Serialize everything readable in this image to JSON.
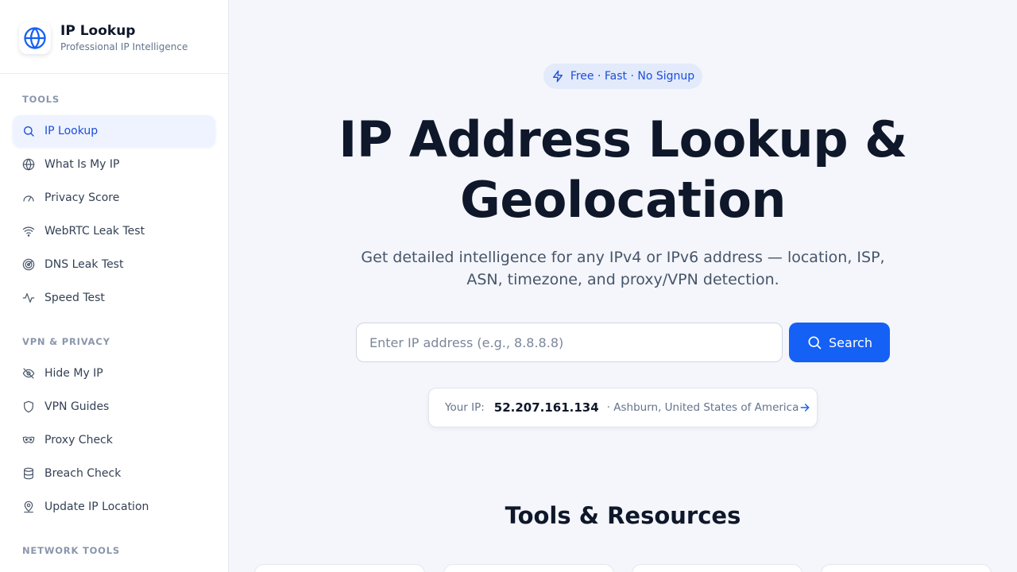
{
  "brand": {
    "title": "IP Lookup",
    "subtitle": "Professional IP Intelligence",
    "logo_icon": "globe-icon"
  },
  "sidebar": {
    "sections": [
      {
        "heading": "TOOLS",
        "items": [
          {
            "label": "IP Lookup",
            "icon": "search-icon",
            "active": true
          },
          {
            "label": "What Is My IP",
            "icon": "globe-icon"
          },
          {
            "label": "Privacy Score",
            "icon": "gauge-icon"
          },
          {
            "label": "WebRTC Leak Test",
            "icon": "wifi-icon"
          },
          {
            "label": "DNS Leak Test",
            "icon": "radar-icon"
          },
          {
            "label": "Speed Test",
            "icon": "activity-icon"
          }
        ]
      },
      {
        "heading": "VPN & PRIVACY",
        "items": [
          {
            "label": "Hide My IP",
            "icon": "eye-off-icon"
          },
          {
            "label": "VPN Guides",
            "icon": "shield-icon"
          },
          {
            "label": "Proxy Check",
            "icon": "mask-icon"
          },
          {
            "label": "Breach Check",
            "icon": "database-icon"
          },
          {
            "label": "Update IP Location",
            "icon": "map-pin-user-icon"
          }
        ]
      },
      {
        "heading": "NETWORK TOOLS",
        "items": []
      }
    ]
  },
  "hero": {
    "badge": "Free · Fast · No Signup",
    "title_line1": "IP Address Lookup &",
    "title_line2": "Geolocation",
    "subtitle_line1": "Get detailed intelligence for any IPv4 or IPv6 address — location, ISP,",
    "subtitle_line2": "ASN, timezone, and proxy/VPN detection."
  },
  "search": {
    "placeholder": "Enter IP address (e.g., 8.8.8.8)",
    "value": "",
    "button_label": "Search"
  },
  "your_ip": {
    "label": "Your IP:",
    "ip": "52.207.161.134",
    "location": "· Ashburn, United States of America"
  },
  "resources": {
    "title": "Tools & Resources"
  },
  "colors": {
    "accent": "#1560f5",
    "active_bg": "#eef3ff",
    "active_text": "#1d4ed8",
    "badge_bg": "#e2eafb",
    "page_bg": "#f4f6fb"
  }
}
